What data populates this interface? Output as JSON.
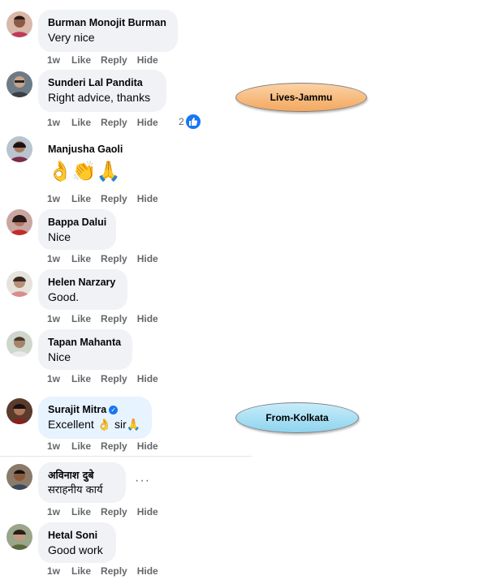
{
  "actions": {
    "time": "1w",
    "like": "Like",
    "reply": "Reply",
    "hide": "Hide"
  },
  "comments": [
    {
      "author": "Burman Monojit Burman",
      "text": "Very nice"
    },
    {
      "author": "Sunderi Lal Pandita",
      "text": "Right advice, thanks",
      "reaction_count": "2"
    },
    {
      "author": "Manjusha Gaoli",
      "emojis": "👌👏🙏"
    },
    {
      "author": "Bappa Dalui",
      "text": "Nice"
    },
    {
      "author": "Helen Narzary",
      "text": "Good."
    },
    {
      "author": "Tapan Mahanta",
      "text": "Nice"
    },
    {
      "author": "Surajit Mitra",
      "text_before": "Excellent",
      "emoji1": "👌",
      "text_after": "sir",
      "emoji2": "🙏",
      "verified": true
    },
    {
      "author": "अविनाश दुबे",
      "text": "सराहनीय कार्य"
    },
    {
      "author": "Hetal Soni",
      "text": "Good work"
    }
  ],
  "annotations": {
    "lives": "Lives-Jammu",
    "from": "From-Kolkata"
  },
  "colors": {
    "bubble": "#f0f2f5",
    "bubble_highlight": "#e7f3ff",
    "link_meta": "#65676b",
    "facebook_blue": "#1877f2"
  },
  "icons": [
    "like-reaction-icon",
    "verified-badge-icon",
    "more-options-icon"
  ]
}
